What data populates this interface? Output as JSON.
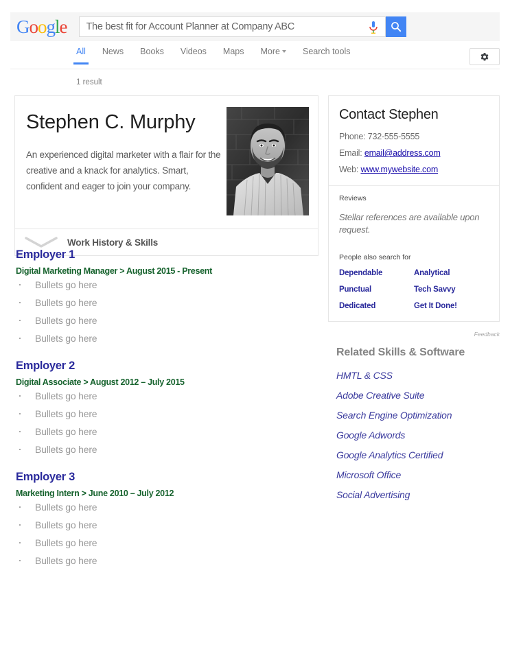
{
  "header": {
    "logo_text": "Google",
    "logo_letters": [
      {
        "ch": "G",
        "color": "#4285f4"
      },
      {
        "ch": "o",
        "color": "#ea4335"
      },
      {
        "ch": "o",
        "color": "#fbbc05"
      },
      {
        "ch": "g",
        "color": "#4285f4"
      },
      {
        "ch": "l",
        "color": "#34a853"
      },
      {
        "ch": "e",
        "color": "#ea4335"
      }
    ],
    "search_value": "The best fit for Account Planner at Company ABC",
    "search_placeholder": "Search",
    "mic_icon": "microphone-icon",
    "search_icon": "search-icon",
    "search_button_color": "#4285f4"
  },
  "nav": {
    "items": [
      {
        "label": "All",
        "active": true
      },
      {
        "label": "News",
        "active": false
      },
      {
        "label": "Books",
        "active": false
      },
      {
        "label": "Videos",
        "active": false
      },
      {
        "label": "Maps",
        "active": false
      },
      {
        "label": "More",
        "active": false,
        "caret": true
      },
      {
        "label": "Search tools",
        "active": false
      }
    ],
    "settings_icon": "gear-icon",
    "active_color": "#4285f4"
  },
  "result_count": "1 result",
  "profile": {
    "name": "Stephen C. Murphy",
    "bio": "An experienced digital marketer with a flair for the creative and a knack for analytics. Smart, confident and eager to join your company.",
    "photo_alt": "portrait-photo",
    "expander": {
      "label": "Work History & Skills",
      "icon": "chevron-down-icon"
    }
  },
  "employers": [
    {
      "name": "Employer 1",
      "role": "Digital Marketing Manager  >  August  2015 - Present",
      "bullets": [
        "Bullets go here",
        "Bullets go here",
        "Bullets go here",
        "Bullets go here"
      ]
    },
    {
      "name": "Employer 2",
      "role": "Digital Associate >  August  2012 – July 2015",
      "bullets": [
        "Bullets go here",
        "Bullets go here",
        "Bullets go here",
        "Bullets go here"
      ]
    },
    {
      "name": "Employer 3",
      "role": "Marketing Intern >  June 2010 – July 2012",
      "bullets": [
        "Bullets go here",
        "Bullets go here",
        "Bullets go here",
        "Bullets go here"
      ]
    }
  ],
  "knowledge_panel": {
    "title": "Contact Stephen",
    "phone_label": "Phone:",
    "phone_value": "732-555-5555",
    "email_label": "Email:",
    "email_value": "email@address.com",
    "web_label": "Web:",
    "web_value": "www.mywebsite.com",
    "reviews_heading": "Reviews",
    "reviews_text": "Stellar references are available upon request.",
    "pasf_heading": "People also search for",
    "pasf_items": [
      "Dependable",
      "Analytical",
      "Punctual",
      "Tech Savvy",
      "Dedicated",
      "Get It Done!"
    ],
    "feedback_label": "Feedback",
    "link_color": "#1a0dab",
    "pasf_color": "#2a2a9c"
  },
  "skills": {
    "title": "Related Skills & Software",
    "items": [
      "HMTL & CSS",
      "Adobe Creative Suite",
      "Search Engine Optimization",
      "Google Adwords",
      "Google Analytics Certified",
      "Microsoft Office",
      "Social Advertising"
    ]
  }
}
